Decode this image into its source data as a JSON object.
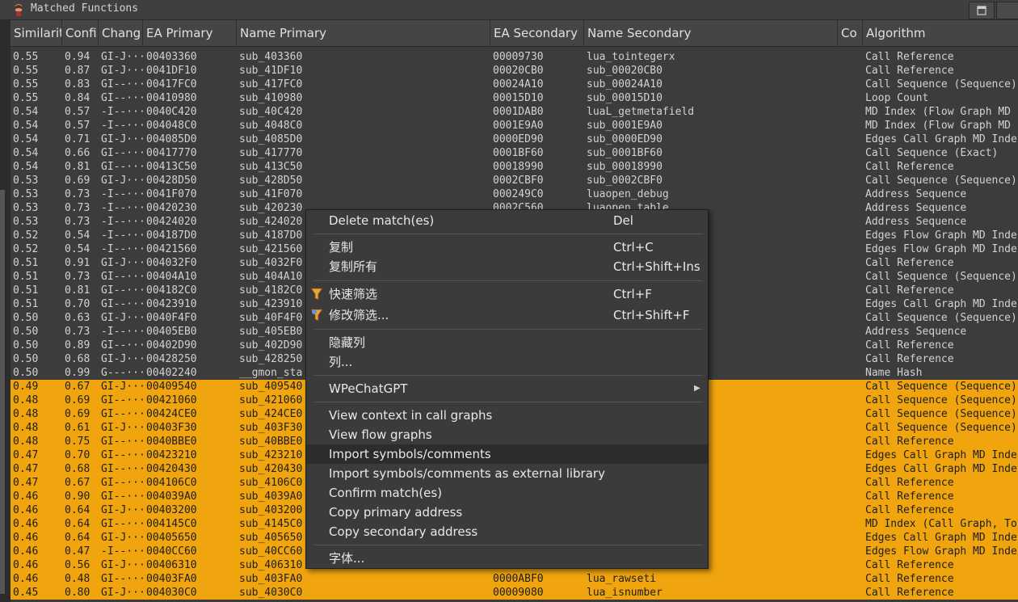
{
  "window": {
    "title": "Matched Functions"
  },
  "columns": [
    "Similarit",
    "Confi",
    "Chang",
    "EA Primary",
    "Name Primary",
    "EA Secondary",
    "Name Secondary",
    "Co",
    "Algorithm"
  ],
  "colors": {
    "highlight_row": "#f0a50f",
    "background": "#3c3c3c"
  },
  "rows": [
    [
      "0.55",
      "0.94",
      "GI-J···",
      "00403360",
      "sub_403360",
      "00009730",
      "lua_tointegerx",
      "",
      "Call Reference"
    ],
    [
      "0.55",
      "0.87",
      "GI-J···",
      "0041DF10",
      "sub_41DF10",
      "00020CB0",
      "sub_00020CB0",
      "",
      "Call Reference"
    ],
    [
      "0.55",
      "0.83",
      "GI--···",
      "00417FC0",
      "sub_417FC0",
      "00024A10",
      "sub_00024A10",
      "",
      "Call Sequence (Sequence)"
    ],
    [
      "0.55",
      "0.84",
      "GI--···",
      "00410980",
      "sub_410980",
      "00015D10",
      "sub_00015D10",
      "",
      "Loop Count"
    ],
    [
      "0.54",
      "0.57",
      "-I--···",
      "0040C420",
      "sub_40C420",
      "0001DAB0",
      "luaL_getmetafield",
      "",
      "MD Index (Flow Graph MD"
    ],
    [
      "0.54",
      "0.57",
      "-I--···",
      "004048C0",
      "sub_4048C0",
      "0001E9A0",
      "sub_0001E9A0",
      "",
      "MD Index (Flow Graph MD"
    ],
    [
      "0.54",
      "0.71",
      "GI-J···",
      "004085D0",
      "sub_4085D0",
      "0000ED90",
      "sub_0000ED90",
      "",
      "Edges Call Graph MD Inde"
    ],
    [
      "0.54",
      "0.66",
      "GI--···",
      "00417770",
      "sub_417770",
      "0001BF60",
      "sub_0001BF60",
      "",
      "Call Sequence (Exact)"
    ],
    [
      "0.54",
      "0.81",
      "GI--···",
      "00413C50",
      "sub_413C50",
      "00018990",
      "sub_00018990",
      "",
      "Call Reference"
    ],
    [
      "0.53",
      "0.69",
      "GI-J···",
      "00428D50",
      "sub_428D50",
      "0002CBF0",
      "sub_0002CBF0",
      "",
      "Call Sequence (Sequence)"
    ],
    [
      "0.53",
      "0.73",
      "-I--···",
      "0041F070",
      "sub_41F070",
      "000249C0",
      "luaopen_debug",
      "",
      "Address Sequence"
    ],
    [
      "0.53",
      "0.73",
      "-I--···",
      "00420230",
      "sub_420230",
      "0002C560",
      "luaopen_table",
      "",
      "Address Sequence"
    ],
    [
      "0.53",
      "0.73",
      "-I--···",
      "00424020",
      "sub_424020",
      "",
      "",
      "",
      "Address Sequence"
    ],
    [
      "0.52",
      "0.54",
      "-I--···",
      "004187D0",
      "sub_4187D0",
      "",
      "",
      "",
      "Edges Flow Graph MD Inde"
    ],
    [
      "0.52",
      "0.54",
      "-I--···",
      "00421560",
      "sub_421560",
      "",
      "",
      "",
      "Edges Flow Graph MD Inde"
    ],
    [
      "0.51",
      "0.91",
      "GI-J···",
      "004032F0",
      "sub_4032F0",
      "",
      "",
      "",
      "Call Reference"
    ],
    [
      "0.51",
      "0.73",
      "GI--···",
      "00404A10",
      "sub_404A10",
      "",
      "",
      "",
      "Call Sequence (Sequence)"
    ],
    [
      "0.51",
      "0.81",
      "GI--···",
      "004182C0",
      "sub_4182C0",
      "",
      "",
      "",
      "Call Reference"
    ],
    [
      "0.51",
      "0.70",
      "GI--···",
      "00423910",
      "sub_423910",
      "",
      "",
      "",
      "Edges Call Graph MD Inde"
    ],
    [
      "0.50",
      "0.63",
      "GI-J···",
      "0040F4F0",
      "sub_40F4F0",
      "",
      "",
      "",
      "Call Sequence (Sequence)"
    ],
    [
      "0.50",
      "0.73",
      "-I--···",
      "00405EB0",
      "sub_405EB0",
      "",
      "",
      "",
      "Address Sequence"
    ],
    [
      "0.50",
      "0.89",
      "GI--···",
      "00402D90",
      "sub_402D90",
      "",
      "",
      "",
      "Call Reference"
    ],
    [
      "0.50",
      "0.68",
      "GI-J···",
      "00428250",
      "sub_428250",
      "",
      "",
      "",
      "Call Reference"
    ],
    [
      "0.50",
      "0.99",
      "G---···",
      "00402240",
      "__gmon_sta",
      "",
      "",
      "",
      "Name Hash"
    ],
    [
      "0.49",
      "0.67",
      "GI-J···",
      "00409540",
      "sub_409540",
      "",
      "",
      "",
      "Call Sequence (Sequence)"
    ],
    [
      "0.48",
      "0.69",
      "GI--···",
      "00421060",
      "sub_421060",
      "",
      "",
      "",
      "Call Sequence (Sequence)"
    ],
    [
      "0.48",
      "0.69",
      "GI--···",
      "00424CE0",
      "sub_424CE0",
      "",
      "",
      "",
      "Call Sequence (Sequence)"
    ],
    [
      "0.48",
      "0.61",
      "GI-J···",
      "00403F30",
      "sub_403F30",
      "",
      "",
      "",
      "Call Sequence (Sequence)"
    ],
    [
      "0.48",
      "0.75",
      "GI--···",
      "0040BBE0",
      "sub_40BBE0",
      "",
      "",
      "",
      "Call Reference"
    ],
    [
      "0.47",
      "0.70",
      "GI--···",
      "00423210",
      "sub_423210",
      "",
      "",
      "",
      "Edges Call Graph MD Inde"
    ],
    [
      "0.47",
      "0.68",
      "GI--···",
      "00420430",
      "sub_420430",
      "",
      "",
      "",
      "Edges Call Graph MD Inde"
    ],
    [
      "0.47",
      "0.67",
      "GI--···",
      "004106C0",
      "sub_4106C0",
      "",
      "",
      "",
      "Call Reference"
    ],
    [
      "0.46",
      "0.90",
      "GI--···",
      "004039A0",
      "sub_4039A0",
      "",
      "",
      "",
      "Call Reference"
    ],
    [
      "0.46",
      "0.64",
      "GI-J···",
      "00403200",
      "sub_403200",
      "",
      "",
      "",
      "Call Reference"
    ],
    [
      "0.46",
      "0.64",
      "GI--···",
      "004145C0",
      "sub_4145C0",
      "",
      "",
      "",
      "MD Index (Call Graph, To"
    ],
    [
      "0.46",
      "0.64",
      "GI-J···",
      "00405650",
      "sub_405650",
      "",
      "",
      "",
      "Edges Call Graph MD Inde"
    ],
    [
      "0.46",
      "0.47",
      "-I--···",
      "0040CC60",
      "sub_40CC60",
      "",
      "",
      "",
      "Edges Flow Graph MD Inde"
    ],
    [
      "0.46",
      "0.56",
      "GI-J···",
      "00406310",
      "sub_406310",
      "",
      "",
      "",
      "Call Reference"
    ],
    [
      "0.46",
      "0.48",
      "GI--···",
      "00403FA0",
      "sub_403FA0",
      "0000ABF0",
      "lua_rawseti",
      "",
      "Call Reference"
    ],
    [
      "0.45",
      "0.80",
      "GI-J···",
      "004030C0",
      "sub_4030C0",
      "00009080",
      "lua_isnumber",
      "",
      "Call Reference"
    ]
  ],
  "context_menu": {
    "delete": {
      "label": "Delete match(es)",
      "shortcut": "Del"
    },
    "copy": {
      "label": "复制",
      "shortcut": "Ctrl+C"
    },
    "copy_all": {
      "label": "复制所有",
      "shortcut": "Ctrl+Shift+Ins"
    },
    "quick_filter": {
      "label": "快速筛选",
      "shortcut": "Ctrl+F",
      "icon": "funnel-icon"
    },
    "modify_filter": {
      "label": "修改筛选...",
      "shortcut": "Ctrl+Shift+F",
      "icon": "funnel-edit-icon"
    },
    "hide_column": {
      "label": "隐藏列"
    },
    "columns": {
      "label": "列..."
    },
    "wpechatgpt": {
      "label": "WPeChatGPT"
    },
    "view_context": {
      "label": "View context in call graphs"
    },
    "view_flow": {
      "label": "View flow graphs"
    },
    "import_symbols": {
      "label": "Import symbols/comments"
    },
    "import_symbols_lib": {
      "label": "Import symbols/comments as external library"
    },
    "confirm_match": {
      "label": "Confirm match(es)"
    },
    "copy_primary": {
      "label": "Copy primary address"
    },
    "copy_secondary": {
      "label": "Copy secondary address"
    },
    "font": {
      "label": "字体..."
    }
  }
}
